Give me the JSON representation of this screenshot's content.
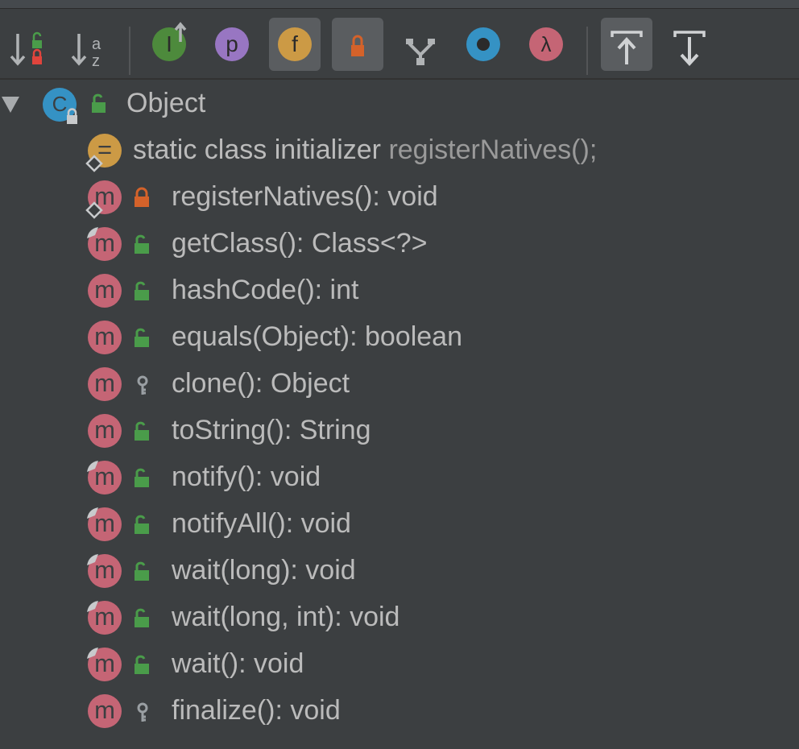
{
  "toolbar": {
    "buttons": [
      {
        "name": "sort-by-visibility-button",
        "icon": "sort-visibility-icon",
        "active": false
      },
      {
        "name": "sort-alphabetically-button",
        "icon": "sort-alpha-icon",
        "glyph_top": "a",
        "glyph_bottom": "z",
        "active": false
      },
      {
        "name": "show-inherited-button",
        "icon": "interface-inherited-icon",
        "glyph": "I",
        "color": "#4d8a3c",
        "active": false
      },
      {
        "name": "show-properties-button",
        "icon": "property-icon",
        "glyph": "p",
        "color": "#9876c2",
        "active": false
      },
      {
        "name": "show-fields-button",
        "icon": "field-icon",
        "glyph": "f",
        "color": "#cc9a45",
        "active": true
      },
      {
        "name": "show-non-public-button",
        "icon": "lock-icon",
        "active": true
      },
      {
        "name": "show-fork-button",
        "icon": "fork-icon",
        "active": false
      },
      {
        "name": "show-anonymous-button",
        "icon": "anonymous-class-icon",
        "color": "#3592c4",
        "active": false
      },
      {
        "name": "show-lambdas-button",
        "icon": "lambda-icon",
        "glyph": "λ",
        "color": "#c56575",
        "active": false
      },
      {
        "name": "autoscroll-to-source-button",
        "icon": "autoscroll-to-source-icon",
        "active": true
      },
      {
        "name": "autoscroll-from-source-button",
        "icon": "autoscroll-from-source-icon",
        "active": false
      }
    ]
  },
  "tree": {
    "root": {
      "label": "Object",
      "class_glyph": "C",
      "expand_icon": "expanded-triangle-icon"
    },
    "initializer": {
      "glyph": "=",
      "label": "static class initializer",
      "detail": "registerNatives();"
    },
    "methods": [
      {
        "label": "registerNatives(): void",
        "visibility": "private",
        "native": true,
        "overrides": false
      },
      {
        "label": "getClass(): Class<?>",
        "visibility": "public",
        "native": true,
        "overrides": true
      },
      {
        "label": "hashCode(): int",
        "visibility": "public",
        "native": false,
        "overrides": false
      },
      {
        "label": "equals(Object): boolean",
        "visibility": "public",
        "native": false,
        "overrides": false
      },
      {
        "label": "clone(): Object",
        "visibility": "protected",
        "native": false,
        "overrides": false
      },
      {
        "label": "toString(): String",
        "visibility": "public",
        "native": false,
        "overrides": false
      },
      {
        "label": "notify(): void",
        "visibility": "public",
        "native": false,
        "overrides": true
      },
      {
        "label": "notifyAll(): void",
        "visibility": "public",
        "native": false,
        "overrides": true
      },
      {
        "label": "wait(long): void",
        "visibility": "public",
        "native": false,
        "overrides": true
      },
      {
        "label": "wait(long, int): void",
        "visibility": "public",
        "native": false,
        "overrides": true
      },
      {
        "label": "wait(): void",
        "visibility": "public",
        "native": false,
        "overrides": true
      },
      {
        "label": "finalize(): void",
        "visibility": "protected",
        "native": false,
        "overrides": false
      }
    ],
    "method_glyph": "m",
    "colors": {
      "method": "#c56575",
      "class": "#3592c4",
      "initializer": "#cc9a45",
      "public_lock": "#4a9c4a",
      "private_lock": "#d4622a",
      "protected_key": "#9a9fa3"
    }
  }
}
